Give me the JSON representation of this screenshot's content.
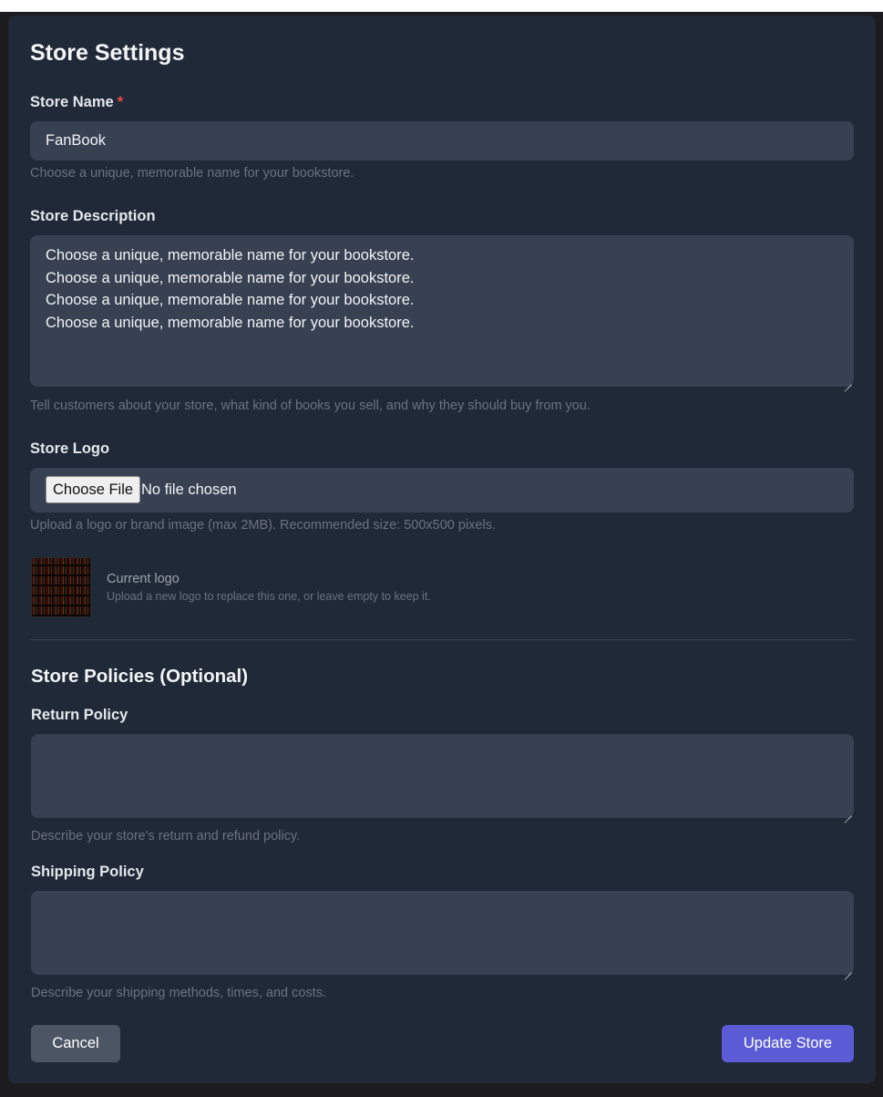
{
  "page": {
    "title": "Store Settings"
  },
  "store_name": {
    "label": "Store Name",
    "required_marker": "*",
    "value": "FanBook",
    "help": "Choose a unique, memorable name for your bookstore."
  },
  "store_description": {
    "label": "Store Description",
    "value": "Choose a unique, memorable name for your bookstore.\nChoose a unique, memorable name for your bookstore.\nChoose a unique, memorable name for your bookstore.\nChoose a unique, memorable name for your bookstore.",
    "help": "Tell customers about your store, what kind of books you sell, and why they should buy from you."
  },
  "store_logo": {
    "label": "Store Logo",
    "choose_file_label": "Choose File",
    "file_status": "No file chosen",
    "help": "Upload a logo or brand image (max 2MB). Recommended size: 500x500 pixels.",
    "current_logo_caption": "Current logo",
    "current_logo_hint": "Upload a new logo to replace this one, or leave empty to keep it."
  },
  "policies": {
    "section_title": "Store Policies (Optional)",
    "return_policy": {
      "label": "Return Policy",
      "value": "",
      "help": "Describe your store's return and refund policy."
    },
    "shipping_policy": {
      "label": "Shipping Policy",
      "value": "",
      "help": "Describe your shipping methods, times, and costs."
    }
  },
  "actions": {
    "cancel_label": "Cancel",
    "submit_label": "Update Store"
  },
  "colors": {
    "card_background": "#1f2937",
    "field_background": "#374151",
    "primary": "#5b5bd6",
    "secondary_button": "#4b5563",
    "required": "#ef4444"
  }
}
